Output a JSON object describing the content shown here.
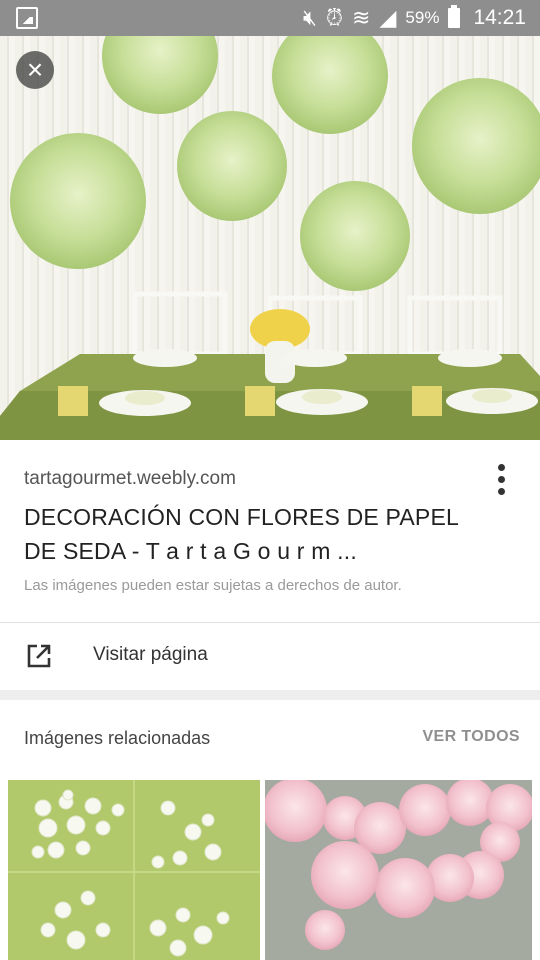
{
  "status_bar": {
    "battery": "59%",
    "time": "14:21",
    "icons": [
      "gallery-icon",
      "mute-icon",
      "alarm-icon",
      "wifi-icon",
      "signal-icon",
      "battery-icon"
    ]
  },
  "hero": {
    "close_icon": "close-icon"
  },
  "result": {
    "domain": "tartagourmet.weebly.com",
    "title": "DECORACIÓN CON FLORES DE PAPEL DE SEDA - T a r t a G o u r m ...",
    "copyright_notice": "Las imágenes pueden estar sujetas a derechos de autor.",
    "visit_label": "Visitar página",
    "visit_icon": "open-in-new-icon",
    "menu_icon": "more-vert-icon"
  },
  "related": {
    "heading": "Imágenes relacionadas",
    "see_all": "VER TODOS"
  },
  "colors": {
    "status_bar": "#8e8e8e",
    "card_bg": "#ffffff",
    "page_bg": "#eeeeee",
    "pompom_green": "#cfe4a6",
    "pompom_pink": "#f2c9d3"
  }
}
